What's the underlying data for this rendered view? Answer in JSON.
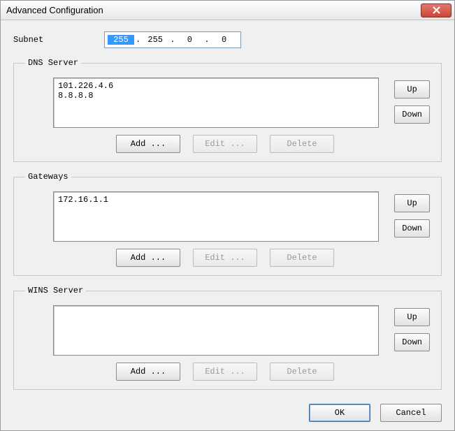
{
  "window": {
    "title": "Advanced Configuration"
  },
  "subnet": {
    "label": "Subnet",
    "octets": [
      "255",
      "255",
      "0",
      "0"
    ],
    "selected_index": 0
  },
  "groups": {
    "dns": {
      "legend": "DNS Server",
      "items": [
        "101.226.4.6",
        "8.8.8.8"
      ],
      "up": "Up",
      "down": "Down",
      "add": "Add ...",
      "edit": "Edit ...",
      "delete": "Delete",
      "edit_enabled": false,
      "delete_enabled": false
    },
    "gateways": {
      "legend": "Gateways",
      "items": [
        "172.16.1.1"
      ],
      "up": "Up",
      "down": "Down",
      "add": "Add ...",
      "edit": "Edit ...",
      "delete": "Delete",
      "edit_enabled": false,
      "delete_enabled": false
    },
    "wins": {
      "legend": "WINS Server",
      "items": [],
      "up": "Up",
      "down": "Down",
      "add": "Add ...",
      "edit": "Edit ...",
      "delete": "Delete",
      "edit_enabled": false,
      "delete_enabled": false
    }
  },
  "footer": {
    "ok": "OK",
    "cancel": "Cancel"
  }
}
